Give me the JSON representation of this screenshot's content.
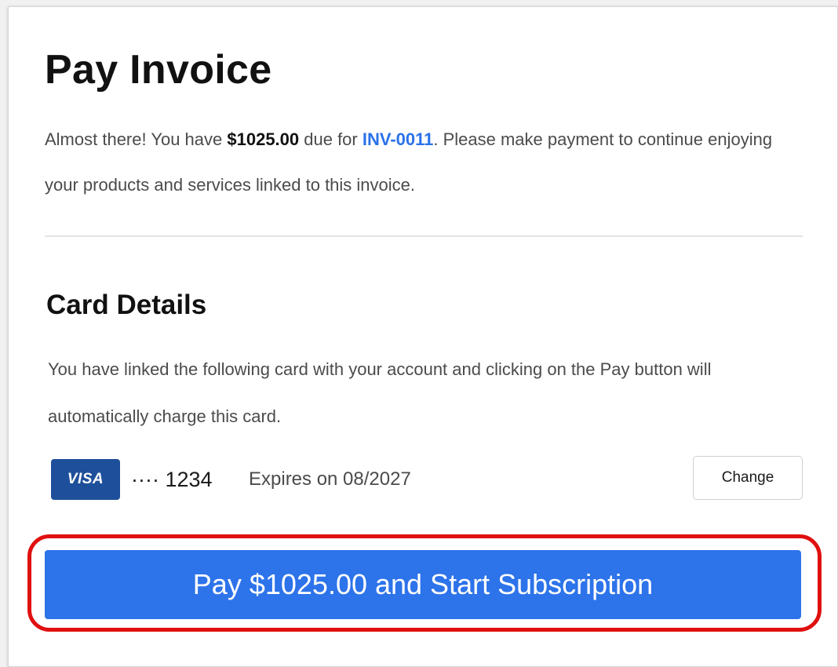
{
  "page": {
    "title": "Pay Invoice"
  },
  "intro": {
    "text_before": "Almost there! You have ",
    "amount": "$1025.00",
    "text_middle": " due for ",
    "invoice_id": "INV-0011",
    "text_after": ". Please make payment to continue enjoying your products and services linked to this invoice."
  },
  "card_details": {
    "heading": "Card Details",
    "description": "You have linked the following card with your account and clicking on the Pay button will automatically charge this card.",
    "brand": "VISA",
    "masked_number": "···· 1234",
    "expiry": "Expires on  08/2027",
    "change_label": "Change"
  },
  "pay_button": {
    "label": "Pay $1025.00 and Start Subscription"
  },
  "colors": {
    "primary": "#2d73ea",
    "link": "#2a72ea",
    "visa_brand": "#1d4f9a",
    "highlight": "#e01010"
  }
}
